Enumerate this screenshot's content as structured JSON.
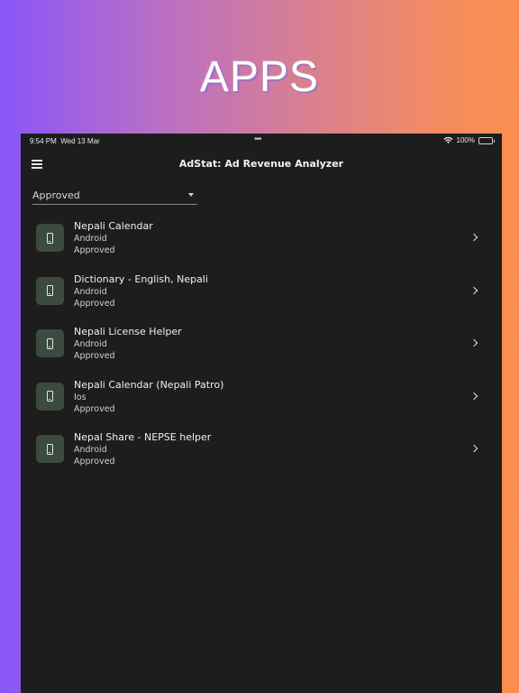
{
  "hero": {
    "title": "APPS"
  },
  "status_bar": {
    "time": "9:54 PM",
    "date": "Wed 13 Mar",
    "dots": "•••",
    "battery": "100%"
  },
  "app_bar": {
    "title": "AdStat: Ad Revenue Analyzer"
  },
  "filter": {
    "selected": "Approved"
  },
  "apps": [
    {
      "name": "Nepali Calendar",
      "platform": "Android",
      "status": "Approved"
    },
    {
      "name": "Dictionary - English, Nepali",
      "platform": "Android",
      "status": "Approved"
    },
    {
      "name": "Nepali License Helper",
      "platform": "Android",
      "status": "Approved"
    },
    {
      "name": "Nepali Calendar (Nepali Patro)",
      "platform": "Ios",
      "status": "Approved"
    },
    {
      "name": "Nepal Share - NEPSE helper",
      "platform": "Android",
      "status": "Approved"
    }
  ],
  "icons": {
    "menu": "menu-icon",
    "app": "phone-icon",
    "chevron": "chevron-right-icon",
    "dropdown": "caret-down-icon",
    "wifi": "wifi-icon",
    "battery": "battery-icon"
  }
}
